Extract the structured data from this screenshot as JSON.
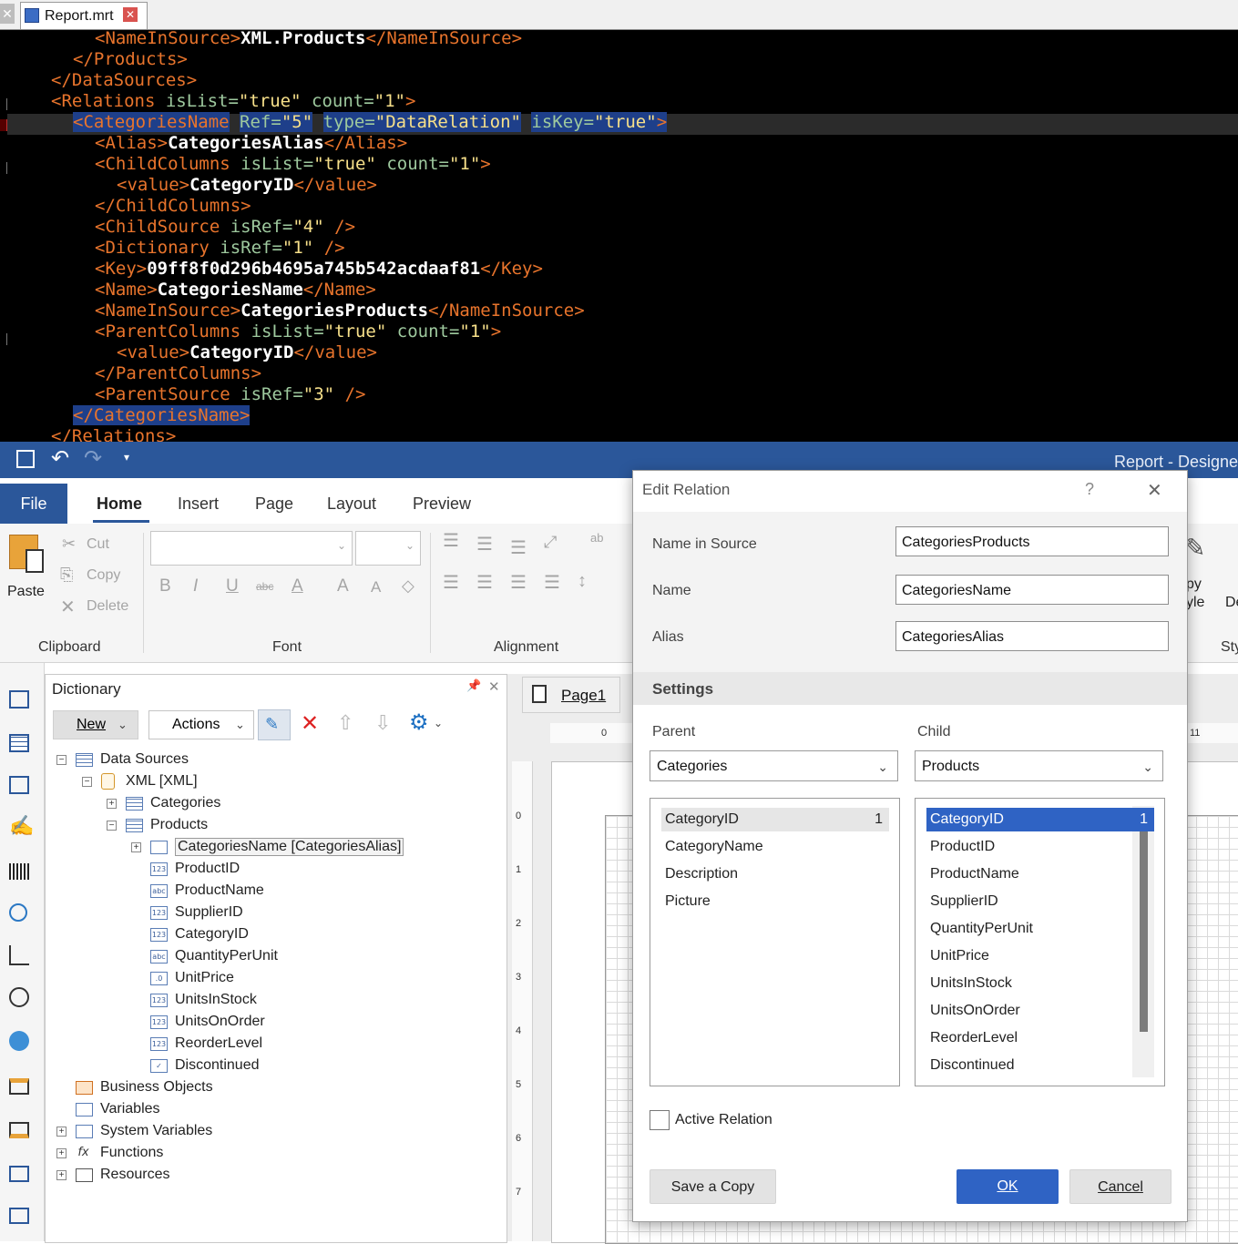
{
  "editor": {
    "tab_title": "Report.mrt",
    "lines": [
      {
        "indent": 4,
        "parts": [
          [
            "t",
            "<NameInSource>"
          ],
          [
            "x",
            "XML.Products"
          ],
          [
            "t",
            "</NameInSource>"
          ]
        ]
      },
      {
        "indent": 3,
        "parts": [
          [
            "t",
            "</Products>"
          ]
        ]
      },
      {
        "indent": 2,
        "parts": [
          [
            "t",
            "</DataSources>"
          ]
        ]
      },
      {
        "indent": 2,
        "parts": [
          [
            "t",
            "<Relations "
          ],
          [
            "a",
            "isList="
          ],
          [
            "v",
            "\"true\" "
          ],
          [
            "a",
            "count="
          ],
          [
            "v",
            "\"1\""
          ],
          [
            "t",
            ">"
          ]
        ]
      },
      {
        "indent": 3,
        "parts": [
          [
            "th",
            "<CategoriesName"
          ],
          [
            "p",
            " "
          ],
          [
            "ah",
            "Ref="
          ],
          [
            "vh",
            "\"5\""
          ],
          [
            "p",
            " "
          ],
          [
            "ah",
            "type="
          ],
          [
            "vh",
            "\"DataRelation\""
          ],
          [
            "p",
            " "
          ],
          [
            "ah",
            "isKey="
          ],
          [
            "vh",
            "\"true\""
          ],
          [
            "th",
            ">"
          ]
        ]
      },
      {
        "indent": 4,
        "parts": [
          [
            "t",
            "<Alias>"
          ],
          [
            "x",
            "CategoriesAlias"
          ],
          [
            "t",
            "</Alias>"
          ]
        ]
      },
      {
        "indent": 4,
        "parts": [
          [
            "t",
            "<ChildColumns "
          ],
          [
            "a",
            "isList="
          ],
          [
            "v",
            "\"true\" "
          ],
          [
            "a",
            "count="
          ],
          [
            "v",
            "\"1\""
          ],
          [
            "t",
            ">"
          ]
        ]
      },
      {
        "indent": 5,
        "parts": [
          [
            "t",
            "<value>"
          ],
          [
            "x",
            "CategoryID"
          ],
          [
            "t",
            "</value>"
          ]
        ]
      },
      {
        "indent": 4,
        "parts": [
          [
            "t",
            "</ChildColumns>"
          ]
        ]
      },
      {
        "indent": 4,
        "parts": [
          [
            "t",
            "<ChildSource "
          ],
          [
            "a",
            "isRef="
          ],
          [
            "v",
            "\"4\" "
          ],
          [
            "t",
            "/>"
          ]
        ]
      },
      {
        "indent": 4,
        "parts": [
          [
            "t",
            "<Dictionary "
          ],
          [
            "a",
            "isRef="
          ],
          [
            "v",
            "\"1\" "
          ],
          [
            "t",
            "/>"
          ]
        ]
      },
      {
        "indent": 4,
        "parts": [
          [
            "t",
            "<Key>"
          ],
          [
            "x",
            "09ff8f0d296b4695a745b542acdaaf81"
          ],
          [
            "t",
            "</Key>"
          ]
        ]
      },
      {
        "indent": 4,
        "parts": [
          [
            "t",
            "<Name>"
          ],
          [
            "x",
            "CategoriesName"
          ],
          [
            "t",
            "</Name>"
          ]
        ]
      },
      {
        "indent": 4,
        "parts": [
          [
            "t",
            "<NameInSource>"
          ],
          [
            "x",
            "CategoriesProducts"
          ],
          [
            "t",
            "</NameInSource>"
          ]
        ]
      },
      {
        "indent": 4,
        "parts": [
          [
            "t",
            "<ParentColumns "
          ],
          [
            "a",
            "isList="
          ],
          [
            "v",
            "\"true\" "
          ],
          [
            "a",
            "count="
          ],
          [
            "v",
            "\"1\""
          ],
          [
            "t",
            ">"
          ]
        ]
      },
      {
        "indent": 5,
        "parts": [
          [
            "t",
            "<value>"
          ],
          [
            "x",
            "CategoryID"
          ],
          [
            "t",
            "</value>"
          ]
        ]
      },
      {
        "indent": 4,
        "parts": [
          [
            "t",
            "</ParentColumns>"
          ]
        ]
      },
      {
        "indent": 4,
        "parts": [
          [
            "t",
            "<ParentSource "
          ],
          [
            "a",
            "isRef="
          ],
          [
            "v",
            "\"3\" "
          ],
          [
            "t",
            "/>"
          ]
        ]
      },
      {
        "indent": 3,
        "parts": [
          [
            "th",
            "</CategoriesName>"
          ]
        ]
      },
      {
        "indent": 2,
        "parts": [
          [
            "t",
            "</Relations>"
          ]
        ]
      }
    ]
  },
  "designer": {
    "window_title": "Report - Designer",
    "tabs": {
      "file": "File",
      "home": "Home",
      "insert": "Insert",
      "page": "Page",
      "layout": "Layout",
      "preview": "Preview"
    },
    "clipboard": {
      "paste": "Paste",
      "cut": "Cut",
      "copy": "Copy",
      "delete": "Delete",
      "group": "Clipboard"
    },
    "font_group": "Font",
    "alignment_group": "Alignment",
    "style_partial": {
      "copy_style_a": "py",
      "copy_style_b": "yle",
      "d": "De",
      "group": "Sty"
    },
    "dictionary": {
      "title": "Dictionary",
      "new_label": "New",
      "actions_label": "Actions",
      "tree": {
        "data_sources": "Data Sources",
        "xml": "XML [XML]",
        "categories": "Categories",
        "products": "Products",
        "relation": "CategoriesName [CategoriesAlias]",
        "columns": [
          {
            "name": "ProductID",
            "icon": "123"
          },
          {
            "name": "ProductName",
            "icon": "abc"
          },
          {
            "name": "SupplierID",
            "icon": "123"
          },
          {
            "name": "CategoryID",
            "icon": "123"
          },
          {
            "name": "QuantityPerUnit",
            "icon": "abc"
          },
          {
            "name": "UnitPrice",
            "icon": ".0"
          },
          {
            "name": "UnitsInStock",
            "icon": "123"
          },
          {
            "name": "UnitsOnOrder",
            "icon": "123"
          },
          {
            "name": "ReorderLevel",
            "icon": "123"
          },
          {
            "name": "Discontinued",
            "icon": "✓"
          }
        ],
        "business_objects": "Business Objects",
        "variables": "Variables",
        "system_variables": "System Variables",
        "functions": "Functions",
        "resources": "Resources"
      }
    },
    "page_tab": "Page1",
    "ruler_top": [
      "0",
      "11"
    ],
    "ruler_left": [
      "0",
      "1",
      "2",
      "3",
      "4",
      "5",
      "6",
      "7"
    ]
  },
  "dialog": {
    "title": "Edit Relation",
    "help": "?",
    "close": "✕",
    "name_in_source_label": "Name in Source",
    "name_in_source_value": "CategoriesProducts",
    "name_label": "Name",
    "name_value": "CategoriesName",
    "alias_label": "Alias",
    "alias_value": "CategoriesAlias",
    "settings_header": "Settings",
    "parent_label": "Parent",
    "parent_value": "Categories",
    "child_label": "Child",
    "child_value": "Products",
    "parent_columns": [
      "CategoryID",
      "CategoryName",
      "Description",
      "Picture"
    ],
    "parent_selected_index": "1",
    "child_columns": [
      "CategoryID",
      "ProductID",
      "ProductName",
      "SupplierID",
      "QuantityPerUnit",
      "UnitPrice",
      "UnitsInStock",
      "UnitsOnOrder",
      "ReorderLevel",
      "Discontinued"
    ],
    "child_selected_index": "1",
    "active_relation_label": "Active Relation",
    "save_copy_label": "Save a Copy",
    "ok_label": "OK",
    "cancel_label": "Cancel",
    "colors": {
      "accent": "#2f63c4",
      "title_bar": "#2b579a",
      "selected_row": "#2f63c4"
    }
  }
}
